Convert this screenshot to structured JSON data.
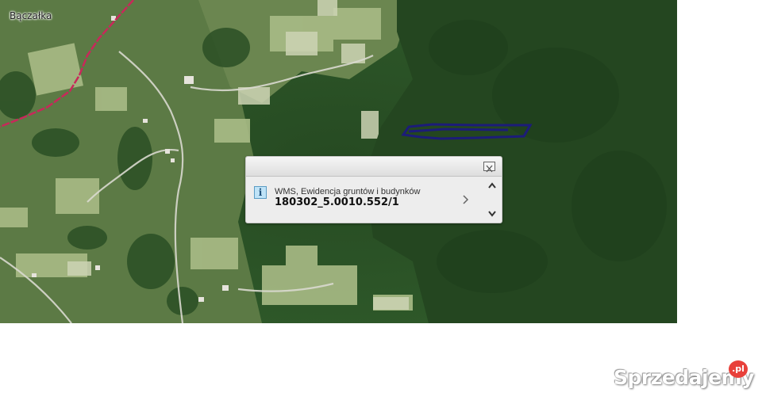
{
  "map": {
    "place_label": "Bączałka",
    "colors": {
      "forest": "#2f5a2a",
      "fields": "#9bb07a",
      "boundary": "#c8285a",
      "parcel": "#1c1c78"
    }
  },
  "popup": {
    "layer_name": "WMS, Ewidencja gruntów i budynków",
    "parcel_id": "180302_5.0010.552/1",
    "icons": {
      "info": "info-icon",
      "close": "close-icon",
      "next": "chevron-right-icon",
      "up": "chevron-up-icon",
      "down": "chevron-down-icon"
    }
  },
  "watermark": {
    "text": "Sprzedajemy",
    "badge": ".pl"
  }
}
